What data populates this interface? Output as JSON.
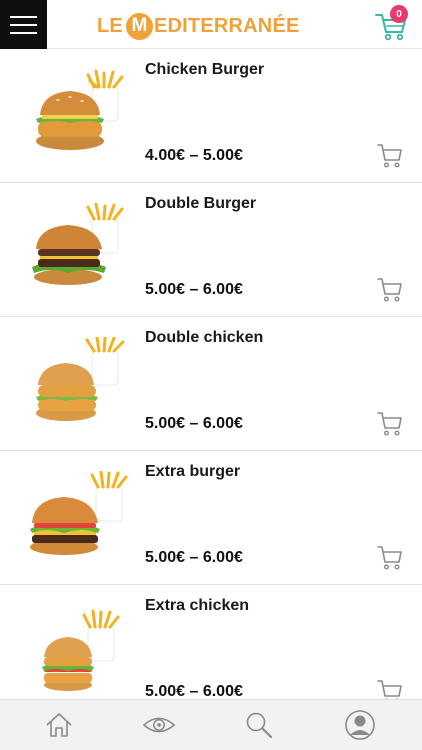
{
  "header": {
    "logo_prefix": "LE",
    "logo_circle_letter": "M",
    "logo_rest": "EDITERRANÉE",
    "cart_count": "0",
    "menu_icon": "hamburger-icon",
    "cart_icon": "cart-icon",
    "accent_color": "#f0a23a",
    "badge_color": "#e83a6e",
    "cart_color": "#3bb5a8"
  },
  "products": [
    {
      "name": "Chicken Burger",
      "price": "4.00€ – 5.00€",
      "image": "chicken-burger-with-fries"
    },
    {
      "name": "Double Burger",
      "price": "5.00€ – 6.00€",
      "image": "double-burger-with-fries"
    },
    {
      "name": "Double chicken",
      "price": "5.00€ – 6.00€",
      "image": "double-chicken-with-fries"
    },
    {
      "name": "Extra burger",
      "price": "5.00€ – 6.00€",
      "image": "extra-burger-with-fries"
    },
    {
      "name": "Extra chicken",
      "price": "5.00€ – 6.00€",
      "image": "extra-chicken-with-fries"
    }
  ],
  "bottom_nav": [
    {
      "icon": "home-icon"
    },
    {
      "icon": "eye-icon"
    },
    {
      "icon": "search-icon"
    },
    {
      "icon": "account-icon"
    }
  ]
}
